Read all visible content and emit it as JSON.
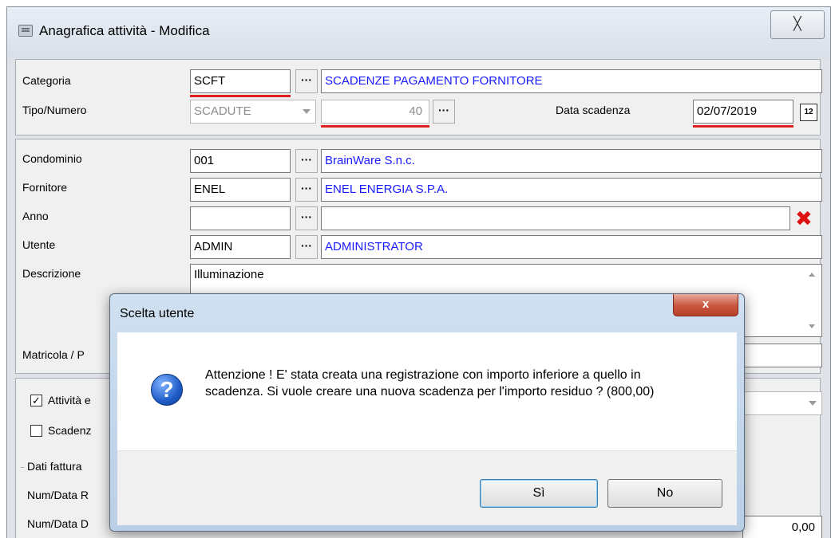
{
  "window": {
    "title": "Anagrafica attività - Modifica",
    "close_label": "╳"
  },
  "header": {
    "categoria_label": "Categoria",
    "categoria_code": "SCFT",
    "categoria_desc": "SCADENZE PAGAMENTO FORNITORE",
    "tipo_label": "Tipo/Numero",
    "tipo_value": "SCADUTE",
    "numero_value": "40",
    "data_scadenza_label": "Data scadenza",
    "data_scadenza_value": "02/07/2019",
    "calendar_glyph": "12"
  },
  "details": {
    "condominio_label": "Condominio",
    "condominio_code": "001",
    "condominio_desc": "BrainWare S.n.c.",
    "fornitore_label": "Fornitore",
    "fornitore_code": "ENEL",
    "fornitore_desc": "ENEL ENERGIA S.P.A.",
    "anno_label": "Anno",
    "anno_code": "",
    "anno_desc": "",
    "utente_label": "Utente",
    "utente_code": "ADMIN",
    "utente_desc": "ADMINISTRATOR",
    "descrizione_label": "Descrizione",
    "descrizione_value": "Illuminazione",
    "matricola_label": "Matricola / P"
  },
  "lower": {
    "attivita_label": "Attività e",
    "scadenza_label": "Scadenz",
    "dati_fattura_label": "Dati fattura",
    "num_data_r_label": "Num/Data R",
    "num_data_d_label": "Num/Data D",
    "importo_value": "0,00"
  },
  "dialog": {
    "title": "Scelta utente",
    "close_label": "x",
    "message": "Attenzione ! E' stata creata una registrazione con importo inferiore a quello in scadenza. Si vuole creare una nuova scadenza per l'importo residuo ? (800,00)",
    "yes_label": "Sì",
    "no_label": "No",
    "icon": "question-icon"
  },
  "colors": {
    "link_blue": "#1a1aff",
    "required_red": "#e02020"
  }
}
